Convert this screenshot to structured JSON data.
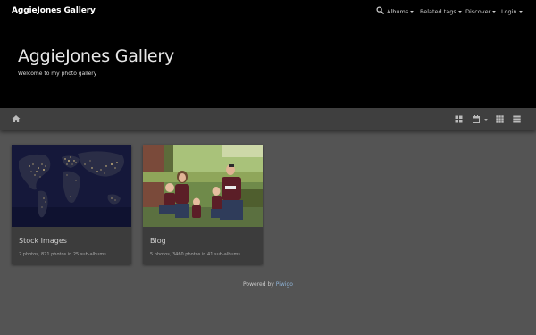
{
  "navbar": {
    "brand": "AggieJones Gallery",
    "items": [
      {
        "label": "Albums"
      },
      {
        "label": "Related tags"
      },
      {
        "label": "Discover"
      },
      {
        "label": "Login"
      }
    ],
    "search_icon": "search-icon"
  },
  "header": {
    "title": "AggieJones Gallery",
    "subtitle": "Welcome to my photo gallery"
  },
  "toolbar": {
    "home_icon": "home-icon",
    "right_icons": [
      "grid-view-icon",
      "calendar-icon",
      "thumbnails-icon",
      "list-view-icon"
    ]
  },
  "albums": [
    {
      "title": "Stock Images",
      "meta": "2 photos, 871 photos in 25 sub-albums",
      "thumbnail": "world-at-night"
    },
    {
      "title": "Blog",
      "meta": "5 photos, 3460 photos in 41 sub-albums",
      "thumbnail": "family-photo"
    }
  ],
  "footer": {
    "prefix": "Powered by",
    "link": "Piwigo"
  },
  "colors": {
    "navbar": "#000000",
    "body": "#545454",
    "toolbar": "#3f3f3f",
    "card": "#3c3c3c",
    "link": "#8fb4d8"
  }
}
